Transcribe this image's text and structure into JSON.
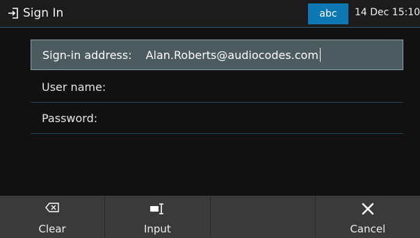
{
  "titlebar": {
    "title": "Sign In",
    "icon": "sign-in-icon",
    "ime_mode": "abc",
    "datetime": "14 Dec 15:10"
  },
  "form": {
    "fields": [
      {
        "label": "Sign-in address:",
        "value": "Alan.Roberts@audiocodes.com",
        "focused": true
      },
      {
        "label": "User name:",
        "value": ""
      },
      {
        "label": "Password:",
        "value": ""
      }
    ]
  },
  "softkeys": [
    {
      "label": "Clear",
      "icon": "backspace-icon"
    },
    {
      "label": "Input",
      "icon": "input-mode-icon"
    },
    {
      "label": "",
      "icon": ""
    },
    {
      "label": "Cancel",
      "icon": "close-icon"
    }
  ],
  "colors": {
    "accent": "#0d78b4",
    "focused_field": "#4b5b60",
    "softkey_bar": "#3a3a3a",
    "background": "#111111"
  }
}
